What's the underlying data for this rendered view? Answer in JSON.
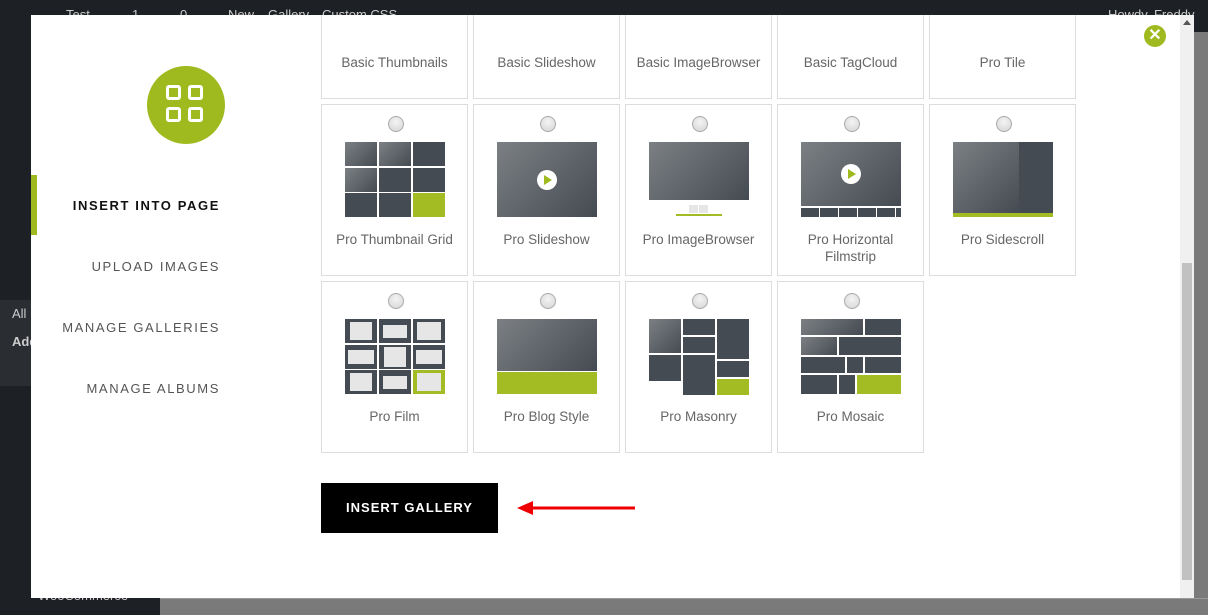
{
  "admin_bar": {
    "site": "Test",
    "comments": "1",
    "updates": "0",
    "new": "New",
    "gallery": "Gallery",
    "custom_css": "Custom CSS",
    "howdy": "Howdy, Freddy"
  },
  "wp_menu": {
    "all": "All",
    "add": "Add",
    "woocommerce": "WooCommerce"
  },
  "modal": {
    "nav": [
      {
        "label": "INSERT INTO PAGE",
        "active": true
      },
      {
        "label": "UPLOAD IMAGES"
      },
      {
        "label": "MANAGE GALLERIES"
      },
      {
        "label": "MANAGE ALBUMS"
      }
    ],
    "close_icon": "close-icon",
    "accent": "#9fba1f",
    "galleries": [
      {
        "label": "Basic Thumbnails",
        "thumb": "basic-thumbnails",
        "selected": false
      },
      {
        "label": "Basic Slideshow",
        "thumb": "basic-slideshow",
        "selected": false
      },
      {
        "label": "Basic ImageBrowser",
        "thumb": "basic-imagebrowser",
        "selected": false
      },
      {
        "label": "Basic TagCloud",
        "thumb": "basic-tagcloud",
        "selected": false
      },
      {
        "label": "Pro Tile",
        "thumb": "pro-tile",
        "selected": false
      },
      {
        "label": "Pro Thumbnail Grid",
        "thumb": "grid",
        "selected": false
      },
      {
        "label": "Pro Slideshow",
        "thumb": "slideshow",
        "selected": false
      },
      {
        "label": "Pro ImageBrowser",
        "thumb": "imagebrowser",
        "selected": false
      },
      {
        "label": "Pro Horizontal Filmstrip",
        "thumb": "filmstrip",
        "selected": false
      },
      {
        "label": "Pro Sidescroll",
        "thumb": "sidescroll",
        "selected": false
      },
      {
        "label": "Pro Film",
        "thumb": "film",
        "selected": false
      },
      {
        "label": "Pro Blog Style",
        "thumb": "blog",
        "selected": false
      },
      {
        "label": "Pro Masonry",
        "thumb": "masonry",
        "selected": false
      },
      {
        "label": "Pro Mosaic",
        "thumb": "mosaic",
        "selected": false
      }
    ],
    "insert_button": "INSERT GALLERY"
  }
}
